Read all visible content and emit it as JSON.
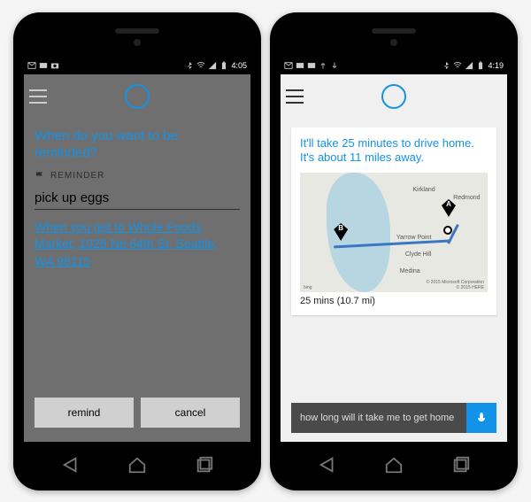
{
  "left": {
    "status": {
      "time": "4:05"
    },
    "prompt": "When do you want to be reminded?",
    "reminder_tag": "REMINDER",
    "task": "pick up eggs",
    "location_link": "When you get to Whole Foods Market, 1026 Ne 64th St, Seattle, WA 98115",
    "buttons": {
      "remind": "remind",
      "cancel": "cancel"
    }
  },
  "right": {
    "status": {
      "time": "4:19"
    },
    "answer": "It'll take 25 minutes to drive home. It's about 11 miles away.",
    "map": {
      "pin_a": "A",
      "pin_b": "B",
      "labels": {
        "kirkland": "Kirkland",
        "redmond": "Redmond",
        "yarrow": "Yarrow Point",
        "clyde": "Clyde Hill",
        "medina": "Medina"
      },
      "bing": "bing",
      "attr1": "© 2015 Microsoft Corporation",
      "attr2": "© 2015 HERE"
    },
    "route_summary": "25 mins (10.7 mi)",
    "input_value": "how long will it take me to get home"
  }
}
